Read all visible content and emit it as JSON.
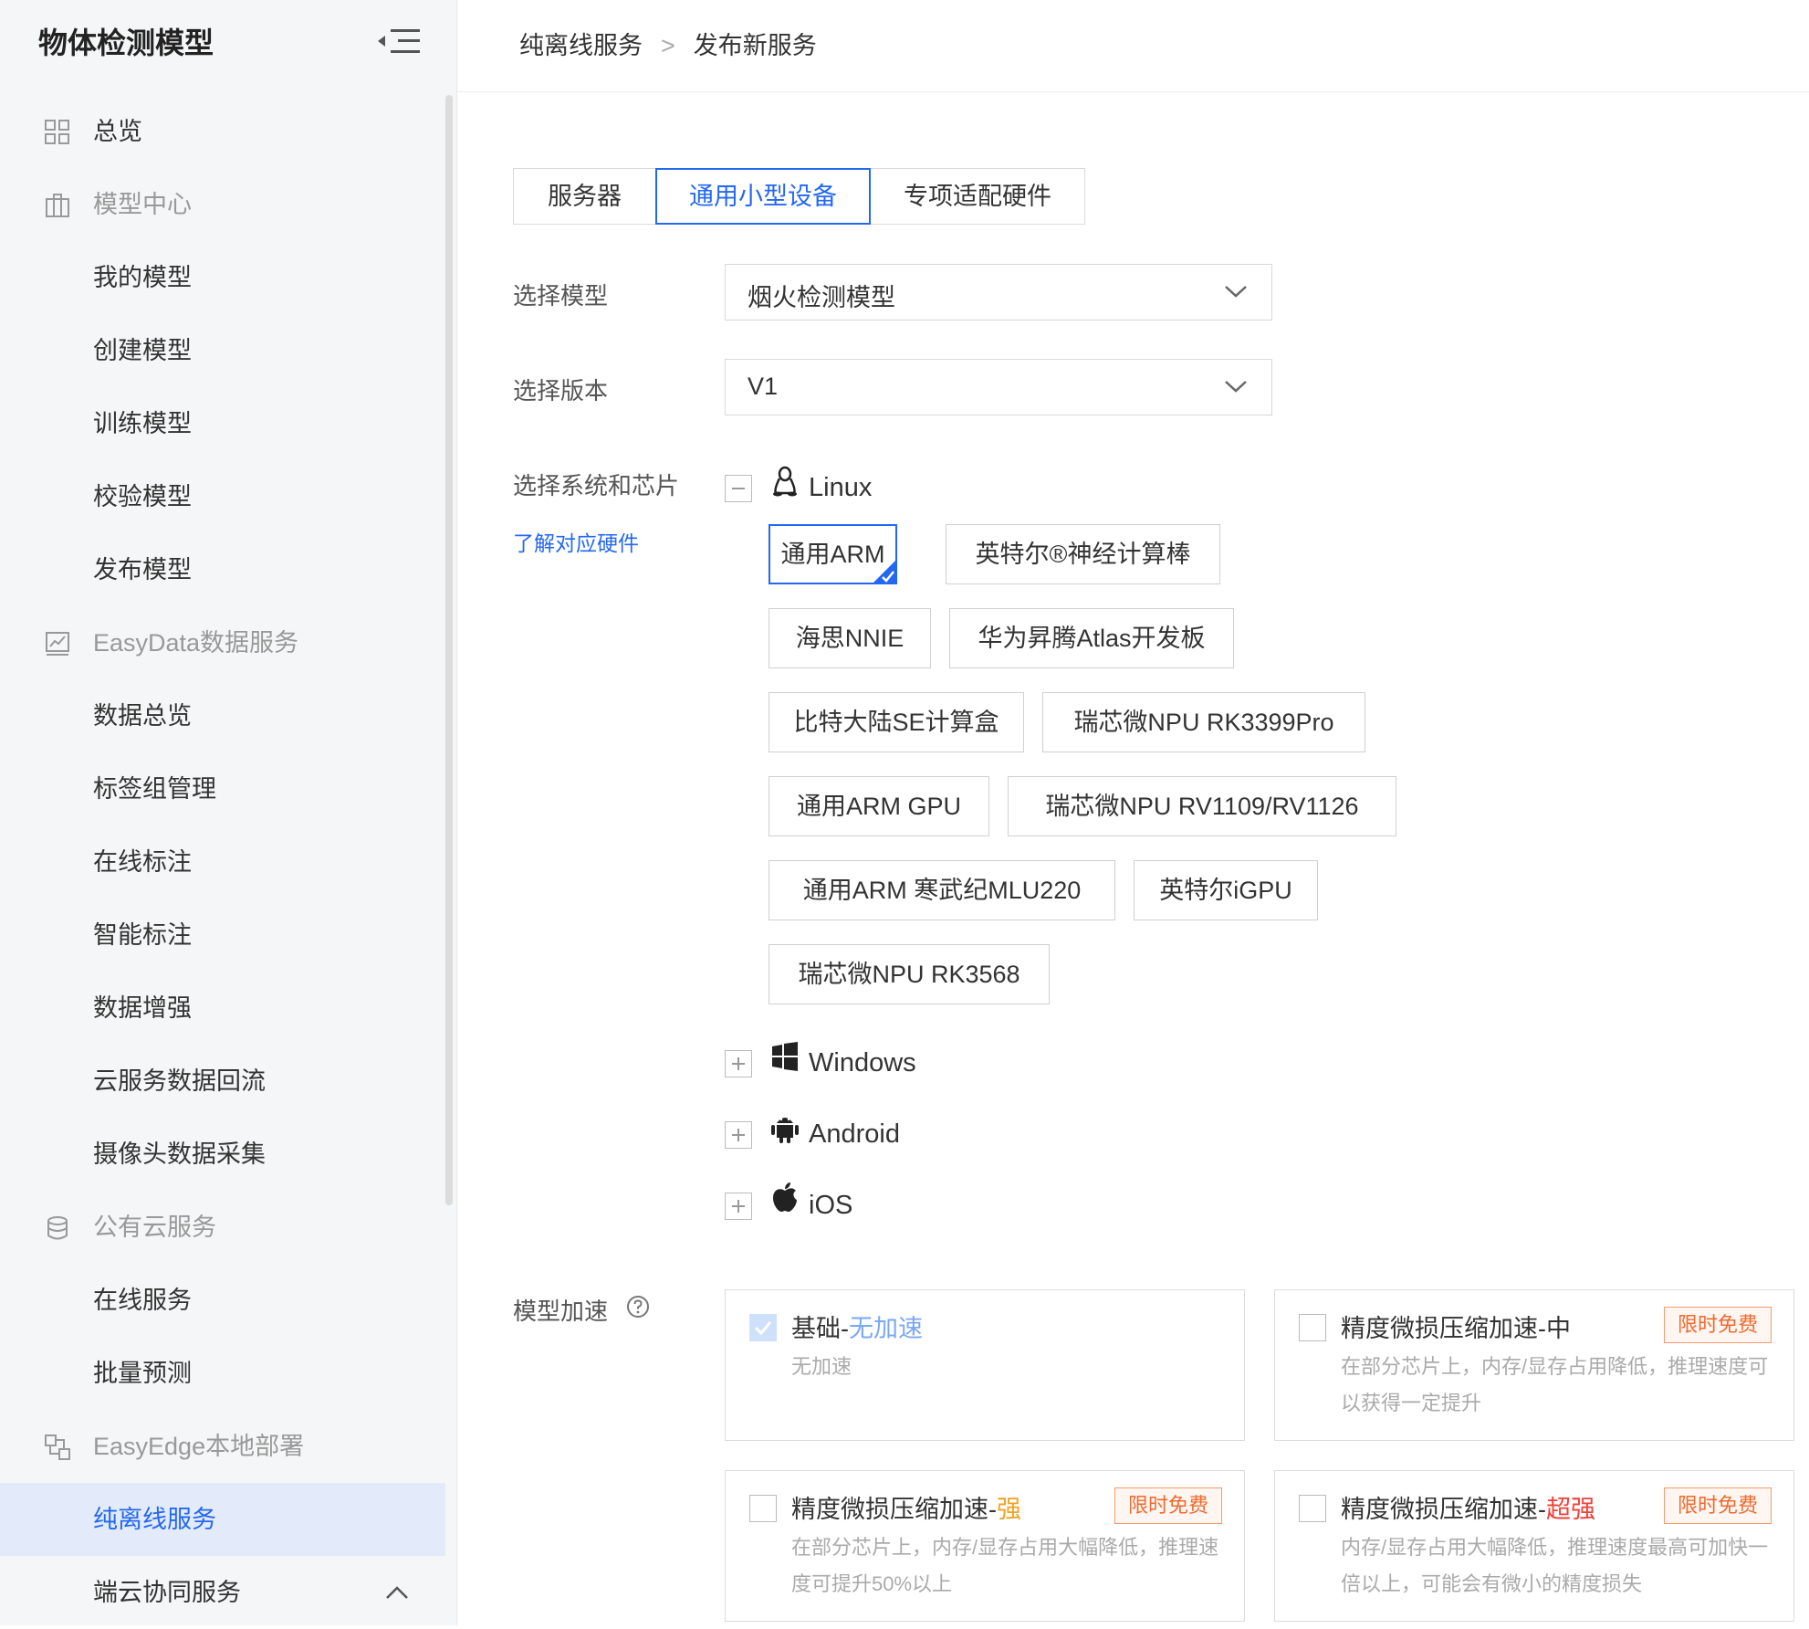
{
  "sidebar": {
    "app_title": "物体检测模型",
    "items": [
      {
        "label": "总览",
        "type": "group",
        "icon": "grid-icon"
      },
      {
        "label": "模型中心",
        "type": "group",
        "icon": "model-center-icon"
      },
      {
        "label": "我的模型",
        "type": "item"
      },
      {
        "label": "创建模型",
        "type": "item"
      },
      {
        "label": "训练模型",
        "type": "item"
      },
      {
        "label": "校验模型",
        "type": "item"
      },
      {
        "label": "发布模型",
        "type": "item"
      },
      {
        "label": "EasyData数据服务",
        "type": "group",
        "icon": "chart-icon"
      },
      {
        "label": "数据总览",
        "type": "item"
      },
      {
        "label": "标签组管理",
        "type": "item"
      },
      {
        "label": "在线标注",
        "type": "item"
      },
      {
        "label": "智能标注",
        "type": "item"
      },
      {
        "label": "数据增强",
        "type": "item"
      },
      {
        "label": "云服务数据回流",
        "type": "item"
      },
      {
        "label": "摄像头数据采集",
        "type": "item"
      },
      {
        "label": "公有云服务",
        "type": "group",
        "icon": "database-icon"
      },
      {
        "label": "在线服务",
        "type": "item"
      },
      {
        "label": "批量预测",
        "type": "item"
      },
      {
        "label": "EasyEdge本地部署",
        "type": "group",
        "icon": "edge-icon"
      },
      {
        "label": "纯离线服务",
        "type": "item",
        "active": true
      },
      {
        "label": "端云协同服务",
        "type": "item",
        "expanded": true
      }
    ]
  },
  "breadcrumb": {
    "parent": "纯离线服务",
    "separator": ">",
    "current": "发布新服务"
  },
  "tabs": [
    {
      "label": "服务器",
      "active": false
    },
    {
      "label": "通用小型设备",
      "active": true
    },
    {
      "label": "专项适配硬件",
      "active": false
    }
  ],
  "form": {
    "model_label": "选择模型",
    "model_value": "烟火检测模型",
    "version_label": "选择版本",
    "version_value": "V1",
    "system_label": "选择系统和芯片",
    "hardware_link": "了解对应硬件",
    "accel_label": "模型加速"
  },
  "os": {
    "linux": {
      "label": "Linux",
      "expanded": true,
      "toggle": "−",
      "icon": "linux-icon"
    },
    "windows": {
      "label": "Windows",
      "expanded": false,
      "toggle": "+",
      "icon": "windows-icon"
    },
    "android": {
      "label": "Android",
      "expanded": false,
      "toggle": "+",
      "icon": "android-icon"
    },
    "ios": {
      "label": "iOS",
      "expanded": false,
      "toggle": "+",
      "icon": "apple-icon"
    }
  },
  "chips": [
    {
      "label": "通用ARM",
      "selected": true
    },
    {
      "label": "英特尔®神经计算棒",
      "selected": false
    },
    {
      "label": "海思NNIE",
      "selected": false
    },
    {
      "label": "华为昇腾Atlas开发板",
      "selected": false
    },
    {
      "label": "比特大陆SE计算盒",
      "selected": false
    },
    {
      "label": "瑞芯微NPU RK3399Pro",
      "selected": false
    },
    {
      "label": "通用ARM GPU",
      "selected": false
    },
    {
      "label": "瑞芯微NPU RV1109/RV1126",
      "selected": false
    },
    {
      "label": "通用ARM 寒武纪MLU220",
      "selected": false
    },
    {
      "label": "英特尔iGPU",
      "selected": false
    },
    {
      "label": "瑞芯微NPU RK3568",
      "selected": false
    }
  ],
  "accel": [
    {
      "title_main": "基础-",
      "title_hl": "无加速",
      "desc": "无加速",
      "checked": true,
      "badge": ""
    },
    {
      "title_main": "精度微损压缩加速-",
      "title_hl": "中",
      "desc": "在部分芯片上，内存/显存占用降低，推理速度可以获得一定提升",
      "checked": false,
      "badge": "限时免费"
    },
    {
      "title_main": "精度微损压缩加速-",
      "title_hl": "强",
      "desc": "在部分芯片上，内存/显存占用大幅降低，推理速度可提升50%以上",
      "checked": false,
      "badge": "限时免费"
    },
    {
      "title_main": "精度微损压缩加速-",
      "title_hl": "超强",
      "desc": "内存/显存占用大幅降低，推理速度最高可加快一倍以上，可能会有微小的精度损失",
      "checked": false,
      "badge": "限时免费"
    }
  ],
  "colors": {
    "accent": "#2468f2",
    "active_bg": "#e3ebfb",
    "badge": "#ef6a2f",
    "strong": "#f0a322",
    "super": "#f0403a"
  }
}
